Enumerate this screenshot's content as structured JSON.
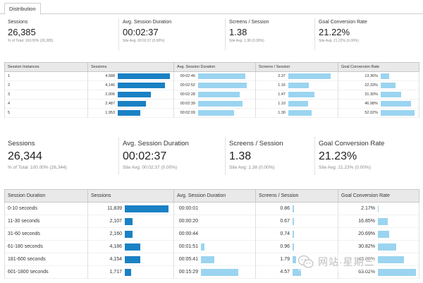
{
  "tab": {
    "label": "Distribution"
  },
  "summary_top": [
    {
      "label": "Sessions",
      "value": "26,385",
      "sub": "% of Total: 100.00% (26,385)"
    },
    {
      "label": "Avg. Session Duration",
      "value": "00:02:37",
      "sub": "Site Avg: 00:02:37 (0.00%)"
    },
    {
      "label": "Screens / Session",
      "value": "1.38",
      "sub": "Site Avg: 1.38 (0.00%)"
    },
    {
      "label": "Goal Conversion Rate",
      "value": "21.22%",
      "sub": "Site Avg: 21.22% (0.00%)"
    }
  ],
  "table_top": {
    "headers": [
      "Session Instances",
      "Sessions",
      "Avg. Session Duration",
      "Screens / Session",
      "Goal Conversion Rate"
    ],
    "rows": [
      {
        "label": "1",
        "sessions": "4,588",
        "duration": "00:02:46",
        "screens": "2.37",
        "goal": "13.36%",
        "sessions_frac": 1.0,
        "duration_frac": 0.95,
        "screens_frac": 1.0,
        "goal_frac": 0.26
      },
      {
        "label": "2",
        "sessions": "4,146",
        "duration": "00:02:52",
        "screens": "1.16",
        "goal": "22.33%",
        "sessions_frac": 0.9,
        "duration_frac": 0.98,
        "screens_frac": 0.49,
        "goal_frac": 0.43
      },
      {
        "label": "3",
        "sessions": "2,906",
        "duration": "00:02:28",
        "screens": "1.47",
        "goal": "31.30%",
        "sessions_frac": 0.63,
        "duration_frac": 0.84,
        "screens_frac": 0.62,
        "goal_frac": 0.6
      },
      {
        "label": "4",
        "sessions": "2,487",
        "duration": "00:02:39",
        "screens": "1.10",
        "goal": "46.98%",
        "sessions_frac": 0.54,
        "duration_frac": 0.9,
        "screens_frac": 0.46,
        "goal_frac": 0.9
      },
      {
        "label": "5",
        "sessions": "1,953",
        "duration": "00:02:09",
        "screens": "1.30",
        "goal": "52.02%",
        "sessions_frac": 0.43,
        "duration_frac": 0.73,
        "screens_frac": 0.55,
        "goal_frac": 1.0
      }
    ]
  },
  "summary_bottom": [
    {
      "label": "Sessions",
      "value": "26,344",
      "sub": "% of Total: 100.00% (26,344)"
    },
    {
      "label": "Avg. Session Duration",
      "value": "00:02:37",
      "sub": "Site Avg: 00:02:37 (0.00%)"
    },
    {
      "label": "Screens / Session",
      "value": "1.38",
      "sub": "Site Avg: 1.38 (0.00%)"
    },
    {
      "label": "Goal Conversion Rate",
      "value": "21.23%",
      "sub": "Site Avg: 21.23% (0.00%)"
    }
  ],
  "table_bottom": {
    "headers": [
      "Session Duration",
      "Sessions",
      "Avg. Session Duration",
      "Screens / Session",
      "Goal Conversion Rate"
    ],
    "rows": [
      {
        "label": "0-10 seconds",
        "sessions": "11,839",
        "duration": "00:00:01",
        "screens": "0.86",
        "goal": "2.17%",
        "sessions_frac": 1.0,
        "duration_frac": 0.0,
        "screens_frac": 0.04,
        "goal_frac": 0.02
      },
      {
        "label": "11-30 seconds",
        "sessions": "2,107",
        "duration": "00:00:20",
        "screens": "0.67",
        "goal": "16.85%",
        "sessions_frac": 0.18,
        "duration_frac": 0.0,
        "screens_frac": 0.03,
        "goal_frac": 0.26
      },
      {
        "label": "31-60 seconds",
        "sessions": "2,160",
        "duration": "00:00:44",
        "screens": "0.74",
        "goal": "20.69%",
        "sessions_frac": 0.18,
        "duration_frac": 0.0,
        "screens_frac": 0.03,
        "goal_frac": 0.3
      },
      {
        "label": "61-180 seconds",
        "sessions": "4,186",
        "duration": "00:01:51",
        "screens": "0.96",
        "goal": "30.82%",
        "sessions_frac": 0.35,
        "duration_frac": 0.07,
        "screens_frac": 0.04,
        "goal_frac": 0.48
      },
      {
        "label": "181-600 seconds",
        "sessions": "4,154",
        "duration": "00:05:41",
        "screens": "1.79",
        "goal": "43.88%",
        "sessions_frac": 0.35,
        "duration_frac": 0.28,
        "screens_frac": 0.08,
        "goal_frac": 0.69
      },
      {
        "label": "601-1800 seconds",
        "sessions": "1,717",
        "duration": "00:15:29",
        "screens": "4.57",
        "goal": "63.02%",
        "sessions_frac": 0.15,
        "duration_frac": 0.78,
        "screens_frac": 0.2,
        "goal_frac": 1.0
      }
    ]
  },
  "watermark": {
    "text": "网站·星期三",
    "icon": "wechat-icon"
  },
  "colors": {
    "bar_primary": "#1a81c4",
    "bar_secondary": "#9bd4f0",
    "header_bg": "#e9e9e9"
  }
}
